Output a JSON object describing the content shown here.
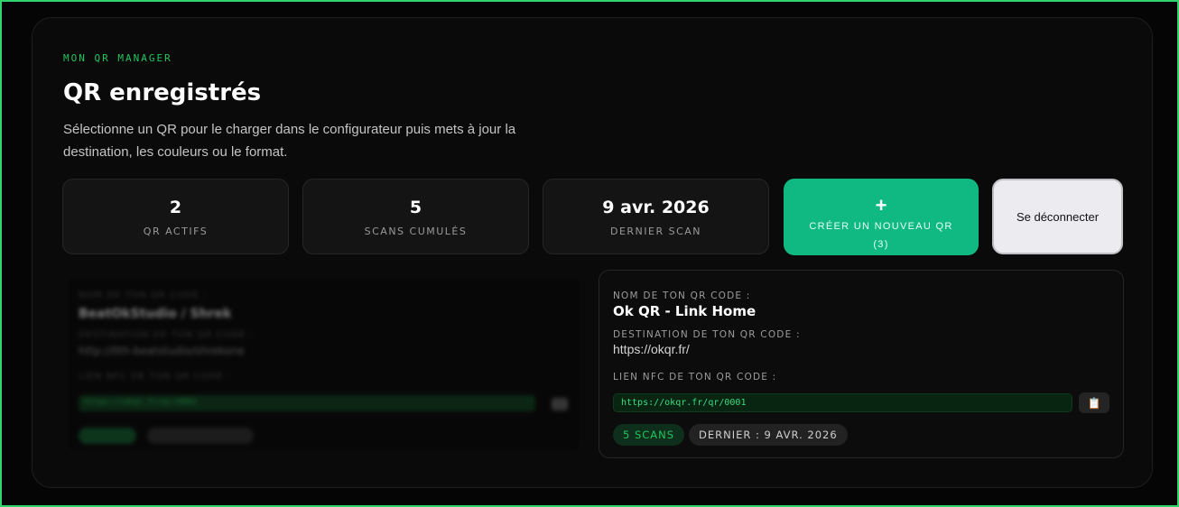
{
  "header": {
    "eyebrow": "MON QR MANAGER",
    "title": "QR enregistrés",
    "subtitle": "Sélectionne un QR pour le charger dans le configurateur puis mets à jour la destination, les couleurs ou le format."
  },
  "stats": [
    {
      "value": "2",
      "label": "QR ACTIFS"
    },
    {
      "value": "5",
      "label": "SCANS CUMULÉS"
    },
    {
      "value": "9 avr. 2026",
      "label": "DERNIER SCAN"
    }
  ],
  "actions": {
    "create_icon": "+",
    "create_label": "CRÉER UN NOUVEAU QR",
    "create_count": "(3)",
    "logout_label": "Se déconnecter"
  },
  "blurred_card": {
    "name_label": "NOM DE TON QR CODE :",
    "name": "BeatOkStudio / Shrek",
    "dest_label": "DESTINATION DE TON QR CODE :",
    "dest": "http://0th-beatstudio/shrekone",
    "nfc_label": "LIEN NFC DE TON QR CODE :",
    "nfc": "https://okqr.fr/qr/0002",
    "chip1": "0 SCANS",
    "chip2": "DERNIER : JAMAIS"
  },
  "qr_card": {
    "name_label": "NOM DE TON QR CODE :",
    "name": "Ok QR - Link Home",
    "dest_label": "DESTINATION DE TON QR CODE :",
    "dest": "https://okqr.fr/",
    "nfc_label": "LIEN NFC DE TON QR CODE :",
    "nfc": "https://okqr.fr/qr/0001",
    "copy_icon": "📋",
    "scans": "5 SCANS",
    "last": "DERNIER : 9 AVR. 2026"
  },
  "colors": {
    "accent": "#22c55e",
    "button_green": "#10b981",
    "border": "#2fd46a"
  }
}
